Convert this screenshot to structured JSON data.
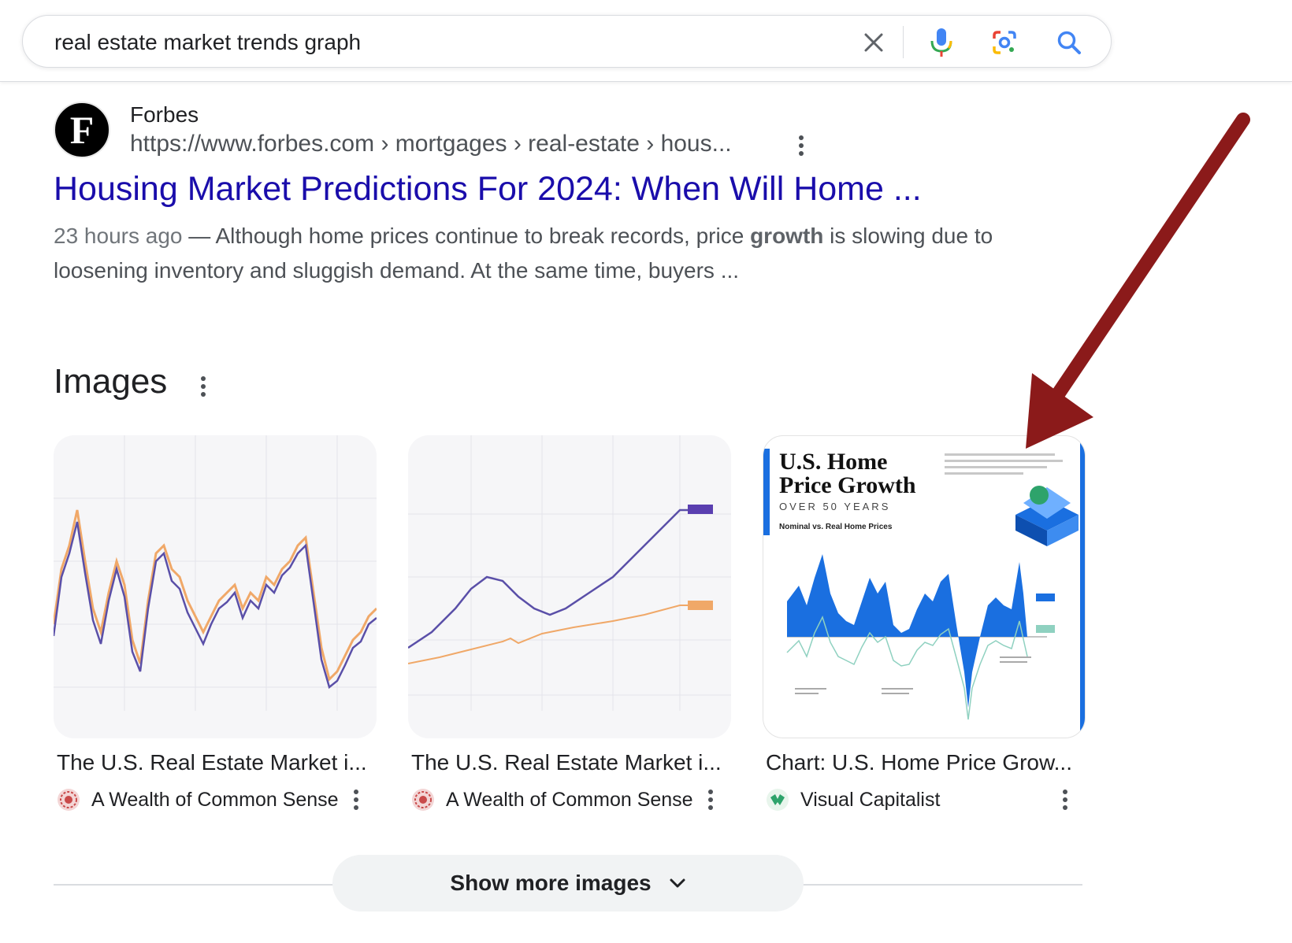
{
  "search": {
    "query": "real estate market trends graph",
    "icons": [
      "close-icon",
      "microphone-icon",
      "lens-icon",
      "search-icon"
    ]
  },
  "result": {
    "favicon_letter": "F",
    "site_name": "Forbes",
    "url": "https://www.forbes.com › mortgages › real-estate › hous...",
    "title": "Housing Market Predictions For 2024: When Will Home ...",
    "snippet": {
      "date": "23 hours ago",
      "dash": " — ",
      "text_before": "Although home prices continue to break records, price ",
      "bold": "growth",
      "text_after": " is slowing due to loosening inventory and sluggish demand. At the same time, buyers ..."
    }
  },
  "images": {
    "heading": "Images",
    "cards": [
      {
        "title": "The U.S. Real Estate Market i...",
        "source": "A Wealth of Common Sense"
      },
      {
        "title": "The U.S. Real Estate Market i...",
        "source": "A Wealth of Common Sense"
      },
      {
        "title": "Chart: U.S. Home Price Grow...",
        "source": "Visual Capitalist",
        "thumb_text": {
          "line1": "U.S. Home",
          "line2": "Price Growth",
          "line3": "OVER 50 YEARS",
          "subtitle": "Nominal vs. Real Home Prices"
        }
      }
    ],
    "show_more": "Show more images"
  },
  "colors": {
    "link": "#1a0dab",
    "snippet": "#4d5156",
    "annotation_arrow": "#8b1a1a",
    "chart_nominal": "#5a4fa8",
    "chart_real": "#f0a868",
    "vc_blue": "#1a6fe0"
  }
}
